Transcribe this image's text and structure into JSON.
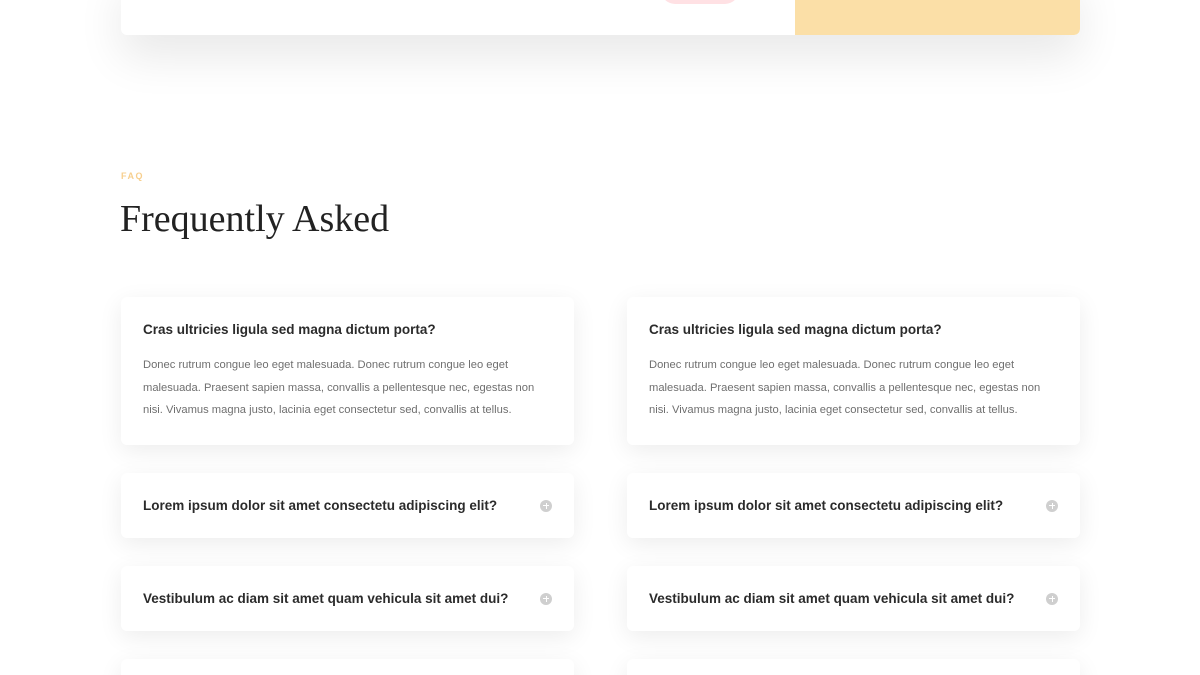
{
  "colors": {
    "accent_yellow": "#fbdfa7",
    "eyebrow": "#f7cf8e",
    "text_dark": "#2b2b2b",
    "text_muted": "#6f6f6f",
    "icon_grey": "#cfcfcf"
  },
  "section": {
    "eyebrow": "FAQ",
    "title": "Frequently Asked"
  },
  "faq": {
    "left": [
      {
        "question": "Cras ultricies ligula sed magna dictum porta?",
        "answer": "Donec rutrum congue leo eget malesuada. Donec rutrum congue leo eget malesuada. Praesent sapien massa, convallis a pellentesque nec, egestas non nisi. Vivamus magna justo, lacinia eget consectetur sed, convallis at tellus.",
        "expanded": true
      },
      {
        "question": "Lorem ipsum dolor sit amet consectetu adipiscing elit?",
        "expanded": false,
        "icon": "plus-circle-icon"
      },
      {
        "question": "Vestibulum ac diam sit amet quam vehicula sit amet dui?",
        "expanded": false,
        "icon": "plus-circle-icon"
      }
    ],
    "right": [
      {
        "question": "Cras ultricies ligula sed magna dictum porta?",
        "answer": "Donec rutrum congue leo eget malesuada. Donec rutrum congue leo eget malesuada. Praesent sapien massa, convallis a pellentesque nec, egestas non nisi. Vivamus magna justo, lacinia eget consectetur sed, convallis at tellus.",
        "expanded": true
      },
      {
        "question": "Lorem ipsum dolor sit amet consectetu adipiscing elit?",
        "expanded": false,
        "icon": "plus-circle-icon"
      },
      {
        "question": "Vestibulum ac diam sit amet quam vehicula sit amet dui?",
        "expanded": false,
        "icon": "plus-circle-icon"
      }
    ]
  }
}
